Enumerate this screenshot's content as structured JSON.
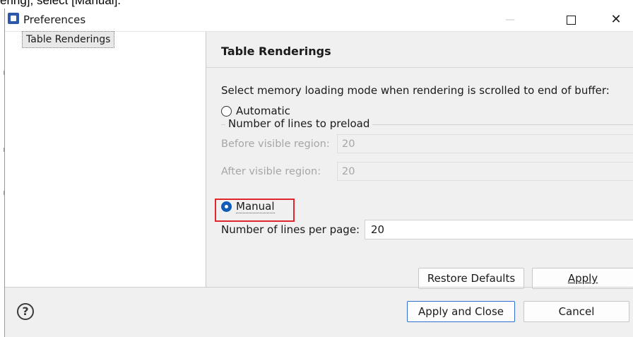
{
  "caption_fragment": "ering], select [Manual].",
  "window": {
    "title": "Preferences",
    "minimize_glyph": "—",
    "close_glyph": "✕"
  },
  "sidebar": {
    "items": [
      {
        "label": "Table Renderings",
        "selected": true
      }
    ]
  },
  "page": {
    "title": "Table Renderings",
    "instruction": "Select memory loading mode when rendering is scrolled to end of buffer:",
    "automatic_label": "Automatic",
    "group_label": "Number of lines to preload",
    "before_label": "Before visible region:",
    "before_value": "20",
    "after_label": "After visible region:",
    "after_value": "20",
    "manual_label": "Manual",
    "mode_selected": "Manual",
    "lines_per_page_label": "Number of lines per page:",
    "lines_per_page_value": "20"
  },
  "buttons": {
    "restore_defaults": "Restore Defaults",
    "apply": "Apply",
    "apply_and_close": "Apply and Close",
    "cancel": "Cancel"
  },
  "icons": {
    "help": "?"
  },
  "colors": {
    "highlight": "#e0262b",
    "radio_selected": "#0f5db8",
    "primary_border": "#2f6fd0"
  }
}
